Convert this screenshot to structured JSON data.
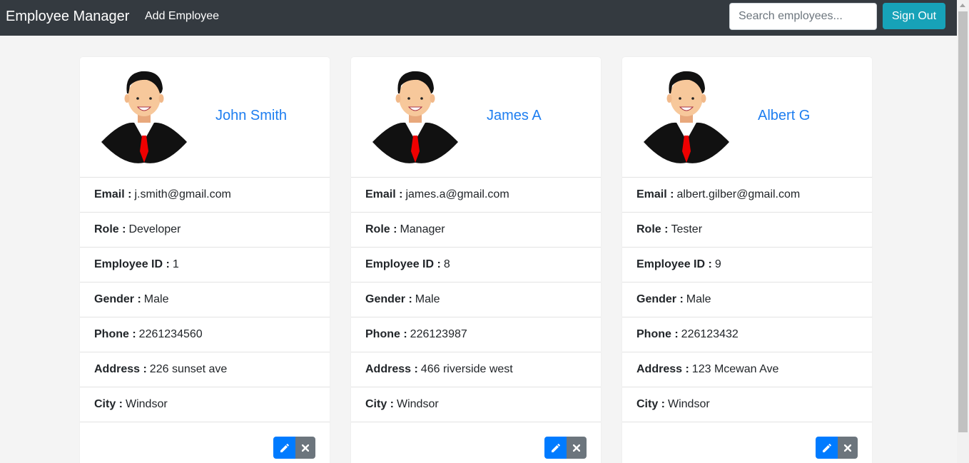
{
  "navbar": {
    "brand": "Employee Manager",
    "add_link": "Add Employee",
    "search_placeholder": "Search employees...",
    "signout_label": "Sign Out"
  },
  "labels": {
    "email": "Email :",
    "role": "Role :",
    "employee_id": "Employee ID :",
    "gender": "Gender :",
    "phone": "Phone :",
    "address": "Address :",
    "city": "City :"
  },
  "employees": [
    {
      "name": "John Smith",
      "email": "j.smith@gmail.com",
      "role": "Developer",
      "employee_id": "1",
      "gender": "Male",
      "phone": "2261234560",
      "address": "226 sunset ave",
      "city": "Windsor"
    },
    {
      "name": "James A",
      "email": "james.a@gmail.com",
      "role": "Manager",
      "employee_id": "8",
      "gender": "Male",
      "phone": "226123987",
      "address": "466 riverside west",
      "city": "Windsor"
    },
    {
      "name": "Albert G",
      "email": "albert.gilber@gmail.com",
      "role": "Tester",
      "employee_id": "9",
      "gender": "Male",
      "phone": "226123432",
      "address": "123 Mcewan Ave",
      "city": "Windsor"
    }
  ],
  "icons": {
    "edit": "pencil-icon",
    "delete": "close-icon"
  },
  "colors": {
    "navbar": "#343a40",
    "signout": "#17a2b8",
    "name": "#1e7ef0",
    "edit": "#007bff",
    "delete": "#6c757d"
  }
}
